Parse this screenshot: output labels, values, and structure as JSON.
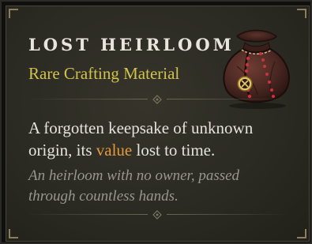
{
  "item": {
    "name": "Lost Heirloom",
    "type": "Rare Crafting Material",
    "description": {
      "before": "A forgotten keepsake of unknown origin, its ",
      "highlight": "value",
      "after": " lost to time."
    },
    "flavor": "An heirloom with no owner, passed through countless hands.",
    "icon": "coin-pouch-icon"
  },
  "colors": {
    "title": "#e9e5dc",
    "rarity": "#d1c34e",
    "highlight": "#e39a3c",
    "flavor": "#9a968c"
  }
}
